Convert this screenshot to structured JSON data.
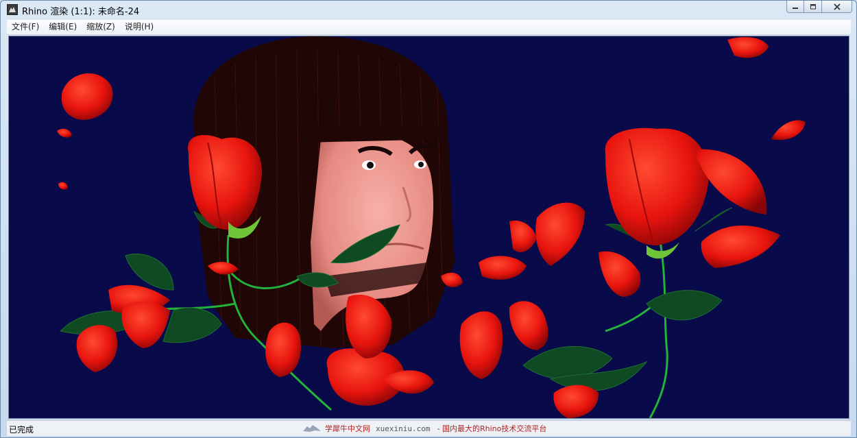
{
  "window": {
    "title": "Rhino 渲染 (1:1): 未命名-24",
    "icon": "rhino-app-icon",
    "buttons": {
      "minimize": "minimize-icon",
      "maximize": "maximize-icon",
      "close": "close-icon"
    }
  },
  "menu": {
    "items": [
      {
        "label": "文件(F)"
      },
      {
        "label": "编辑(E)"
      },
      {
        "label": "缩放(Z)"
      },
      {
        "label": "说明(H)"
      }
    ]
  },
  "render": {
    "background": "#090a4a",
    "accent_rose": "#e8140e",
    "skin": "#f09a92",
    "hair": "#2a0a08",
    "leaf": "#0f4a22",
    "stem": "#22b43a"
  },
  "status": {
    "text": "已完成",
    "watermark_brand": "学犀牛中文网",
    "watermark_site": "xuexiniu.com",
    "watermark_slogan": "- 国内最大的Rhino技术交流平台"
  }
}
